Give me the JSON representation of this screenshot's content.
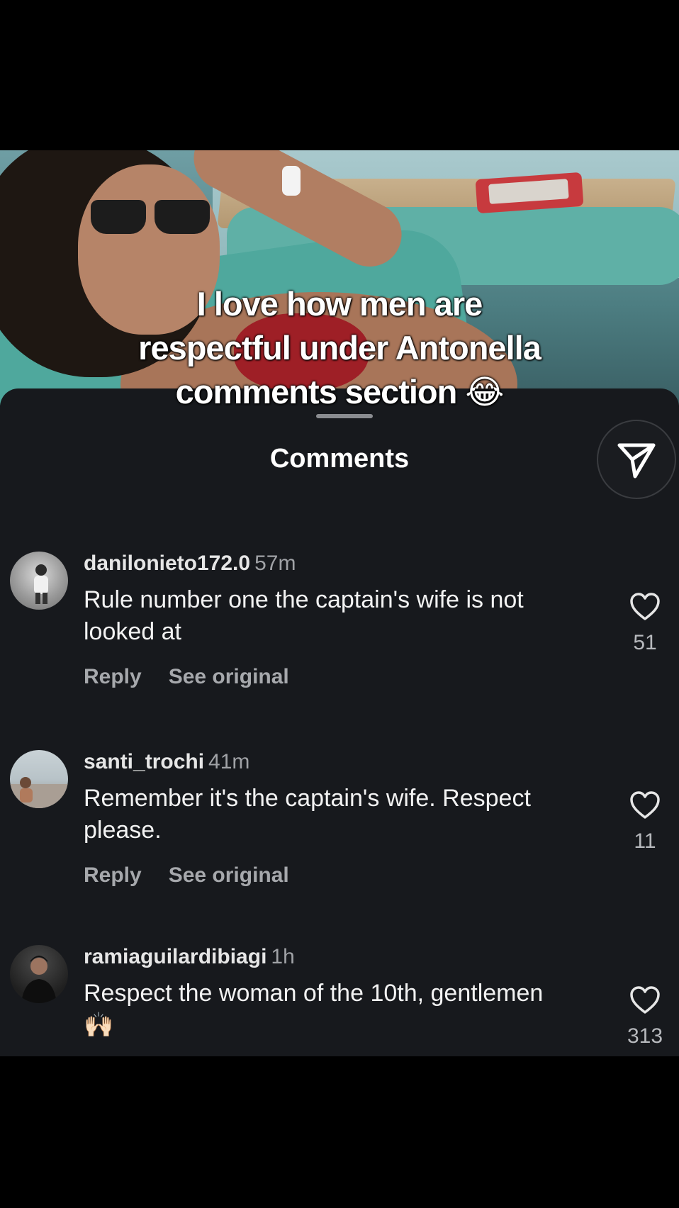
{
  "caption": {
    "line1": "I love how men are",
    "line2": "respectful under Antonella",
    "line3": "comments section 😂"
  },
  "sheet": {
    "title": "Comments"
  },
  "comments": [
    {
      "username": "danilonieto172.0",
      "time": "57m",
      "text": "Rule number one the captain's wife is not looked at",
      "reply": "Reply",
      "see_original": "See original",
      "likes": "51"
    },
    {
      "username": "santi_trochi",
      "time": "41m",
      "text": "Remember it's the captain's wife. Respect please.",
      "reply": "Reply",
      "see_original": "See original",
      "likes": "11"
    },
    {
      "username": "ramiaguilardibiagi",
      "time": "1h",
      "text": "Respect the woman of the 10th, gentlemen 🙌🏻",
      "likes": "313"
    }
  ],
  "icons": {
    "share": "send-icon",
    "like": "heart-icon"
  },
  "colors": {
    "sheet_bg": "#17191d",
    "text_primary": "#f2f2f2",
    "text_secondary": "#a6a8ac"
  }
}
